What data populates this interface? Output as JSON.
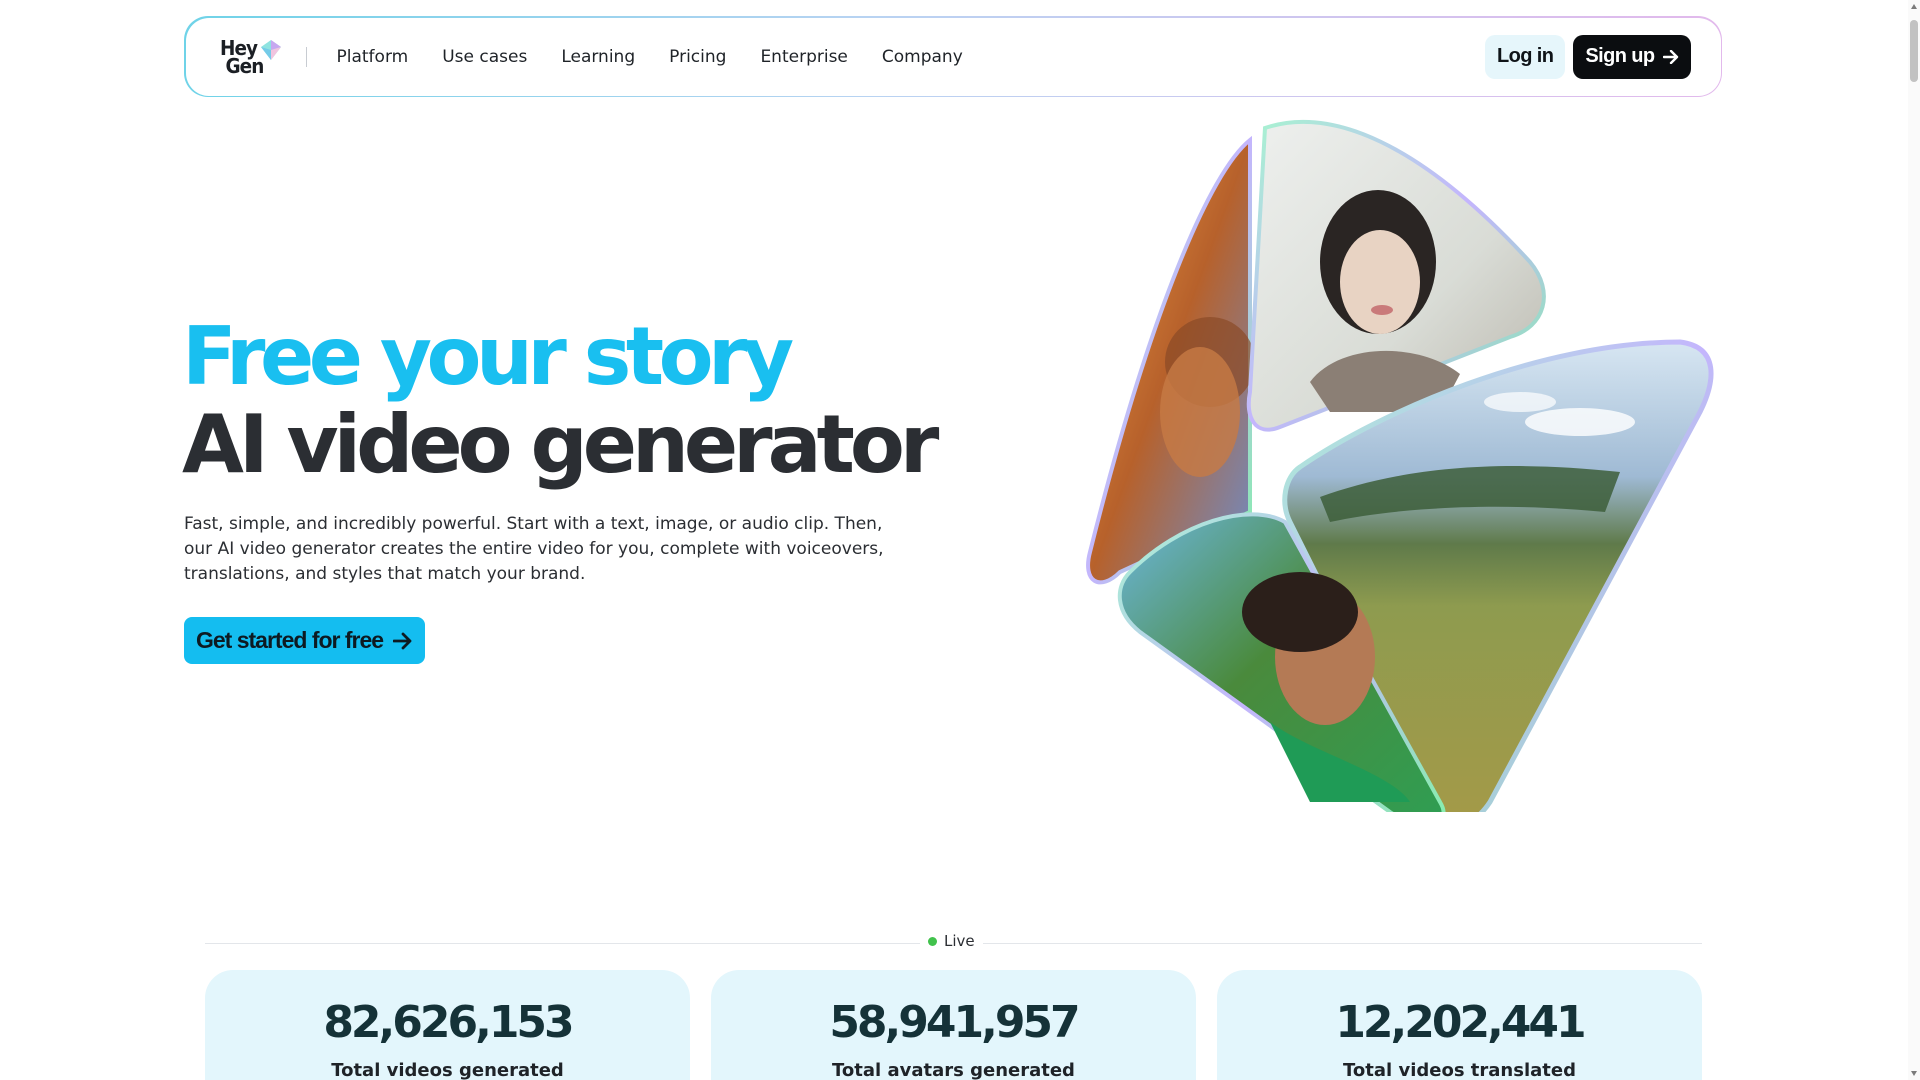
{
  "header": {
    "logo_text": "Hey\n Gen",
    "nav": [
      "Platform",
      "Use cases",
      "Learning",
      "Pricing",
      "Enterprise",
      "Company"
    ],
    "login_label": "Log in",
    "signup_label": "Sign up"
  },
  "hero": {
    "headline_1": "Free your story",
    "headline_2": "AI video generator",
    "description": "Fast, simple, and incredibly powerful. Start with a text, image, or audio clip. Then, our AI video generator creates the entire video for you, complete with voiceovers, translations, and styles that match your brand.",
    "cta_label": "Get started for free"
  },
  "live": {
    "label": "Live"
  },
  "stats": [
    {
      "value": "82,626,153",
      "label": "Total videos generated"
    },
    {
      "value": "58,941,957",
      "label": "Total avatars generated"
    },
    {
      "value": "12,202,441",
      "label": "Total videos translated"
    }
  ],
  "colors": {
    "accent": "#14bdf0",
    "headline_dark": "#2b2e33",
    "live_dot": "#41c24c",
    "stat_card_bg": "#e3f6fc"
  },
  "icons": [
    "heygen-logo-gem",
    "arrow-right-icon"
  ]
}
